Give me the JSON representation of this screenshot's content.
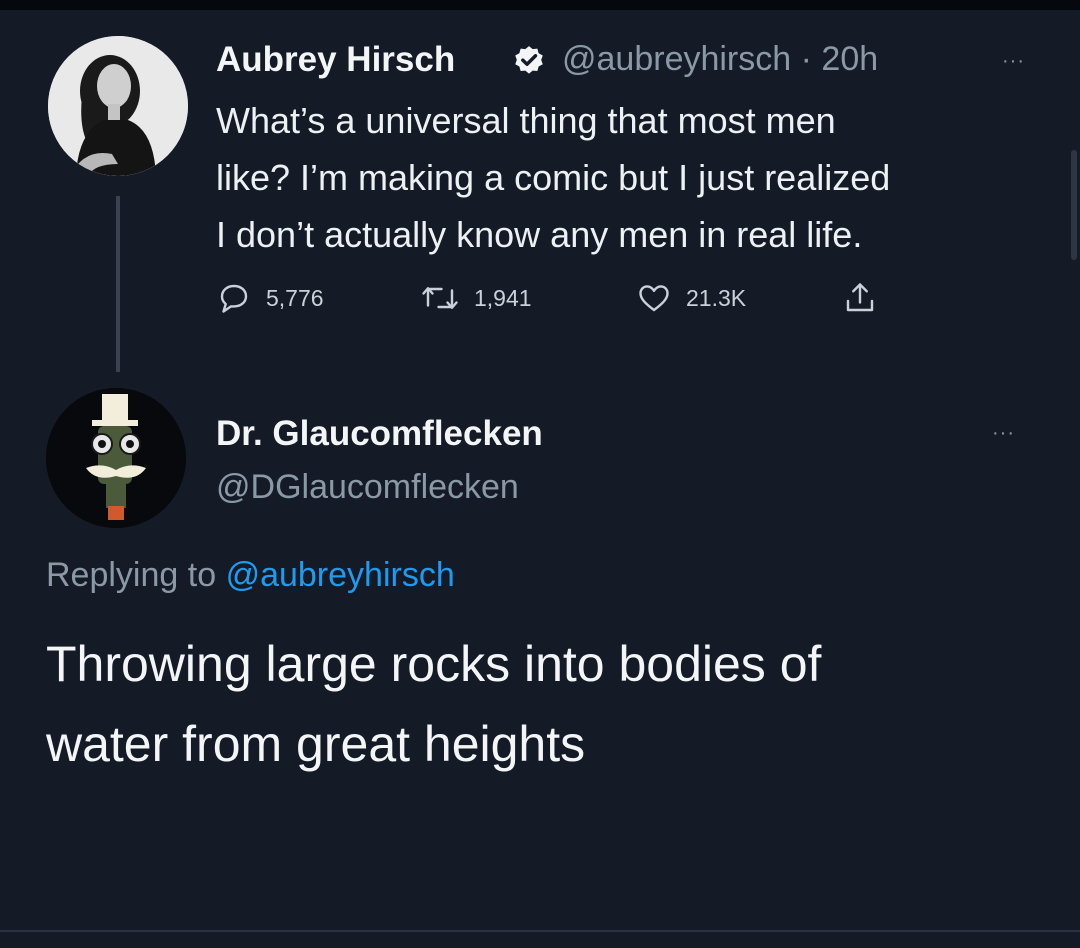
{
  "original_tweet": {
    "author_name": "Aubrey Hirsch",
    "handle": "@aubreyhirsch",
    "separator": "·",
    "time": "20h",
    "more_label": "···",
    "text_lines": [
      "What’s a universal thing that most men",
      "like? I’m making a comic but I just realized",
      "I don’t actually know any men in real life."
    ],
    "stats": {
      "replies": "5,776",
      "retweets": "1,941",
      "likes": "21.3K"
    }
  },
  "reply_tweet": {
    "author_name": "Dr. Glaucomflecken",
    "handle": "@DGlaucomflecken",
    "more_label": "···",
    "replying_prefix": "Replying to",
    "replying_handle": "@aubreyhirsch",
    "text_lines": [
      "Throwing large rocks into bodies of",
      "water from great heights"
    ]
  },
  "colors": {
    "background": "#141b27",
    "text": "#eef1f4",
    "secondary": "#8b98a5",
    "accent": "#1d9bf0"
  },
  "icons": {
    "verified": "verified-badge-icon",
    "reply": "reply-bubble-icon",
    "retweet": "retweet-icon",
    "like": "heart-icon",
    "share": "share-icon",
    "more": "more-options-icon"
  }
}
